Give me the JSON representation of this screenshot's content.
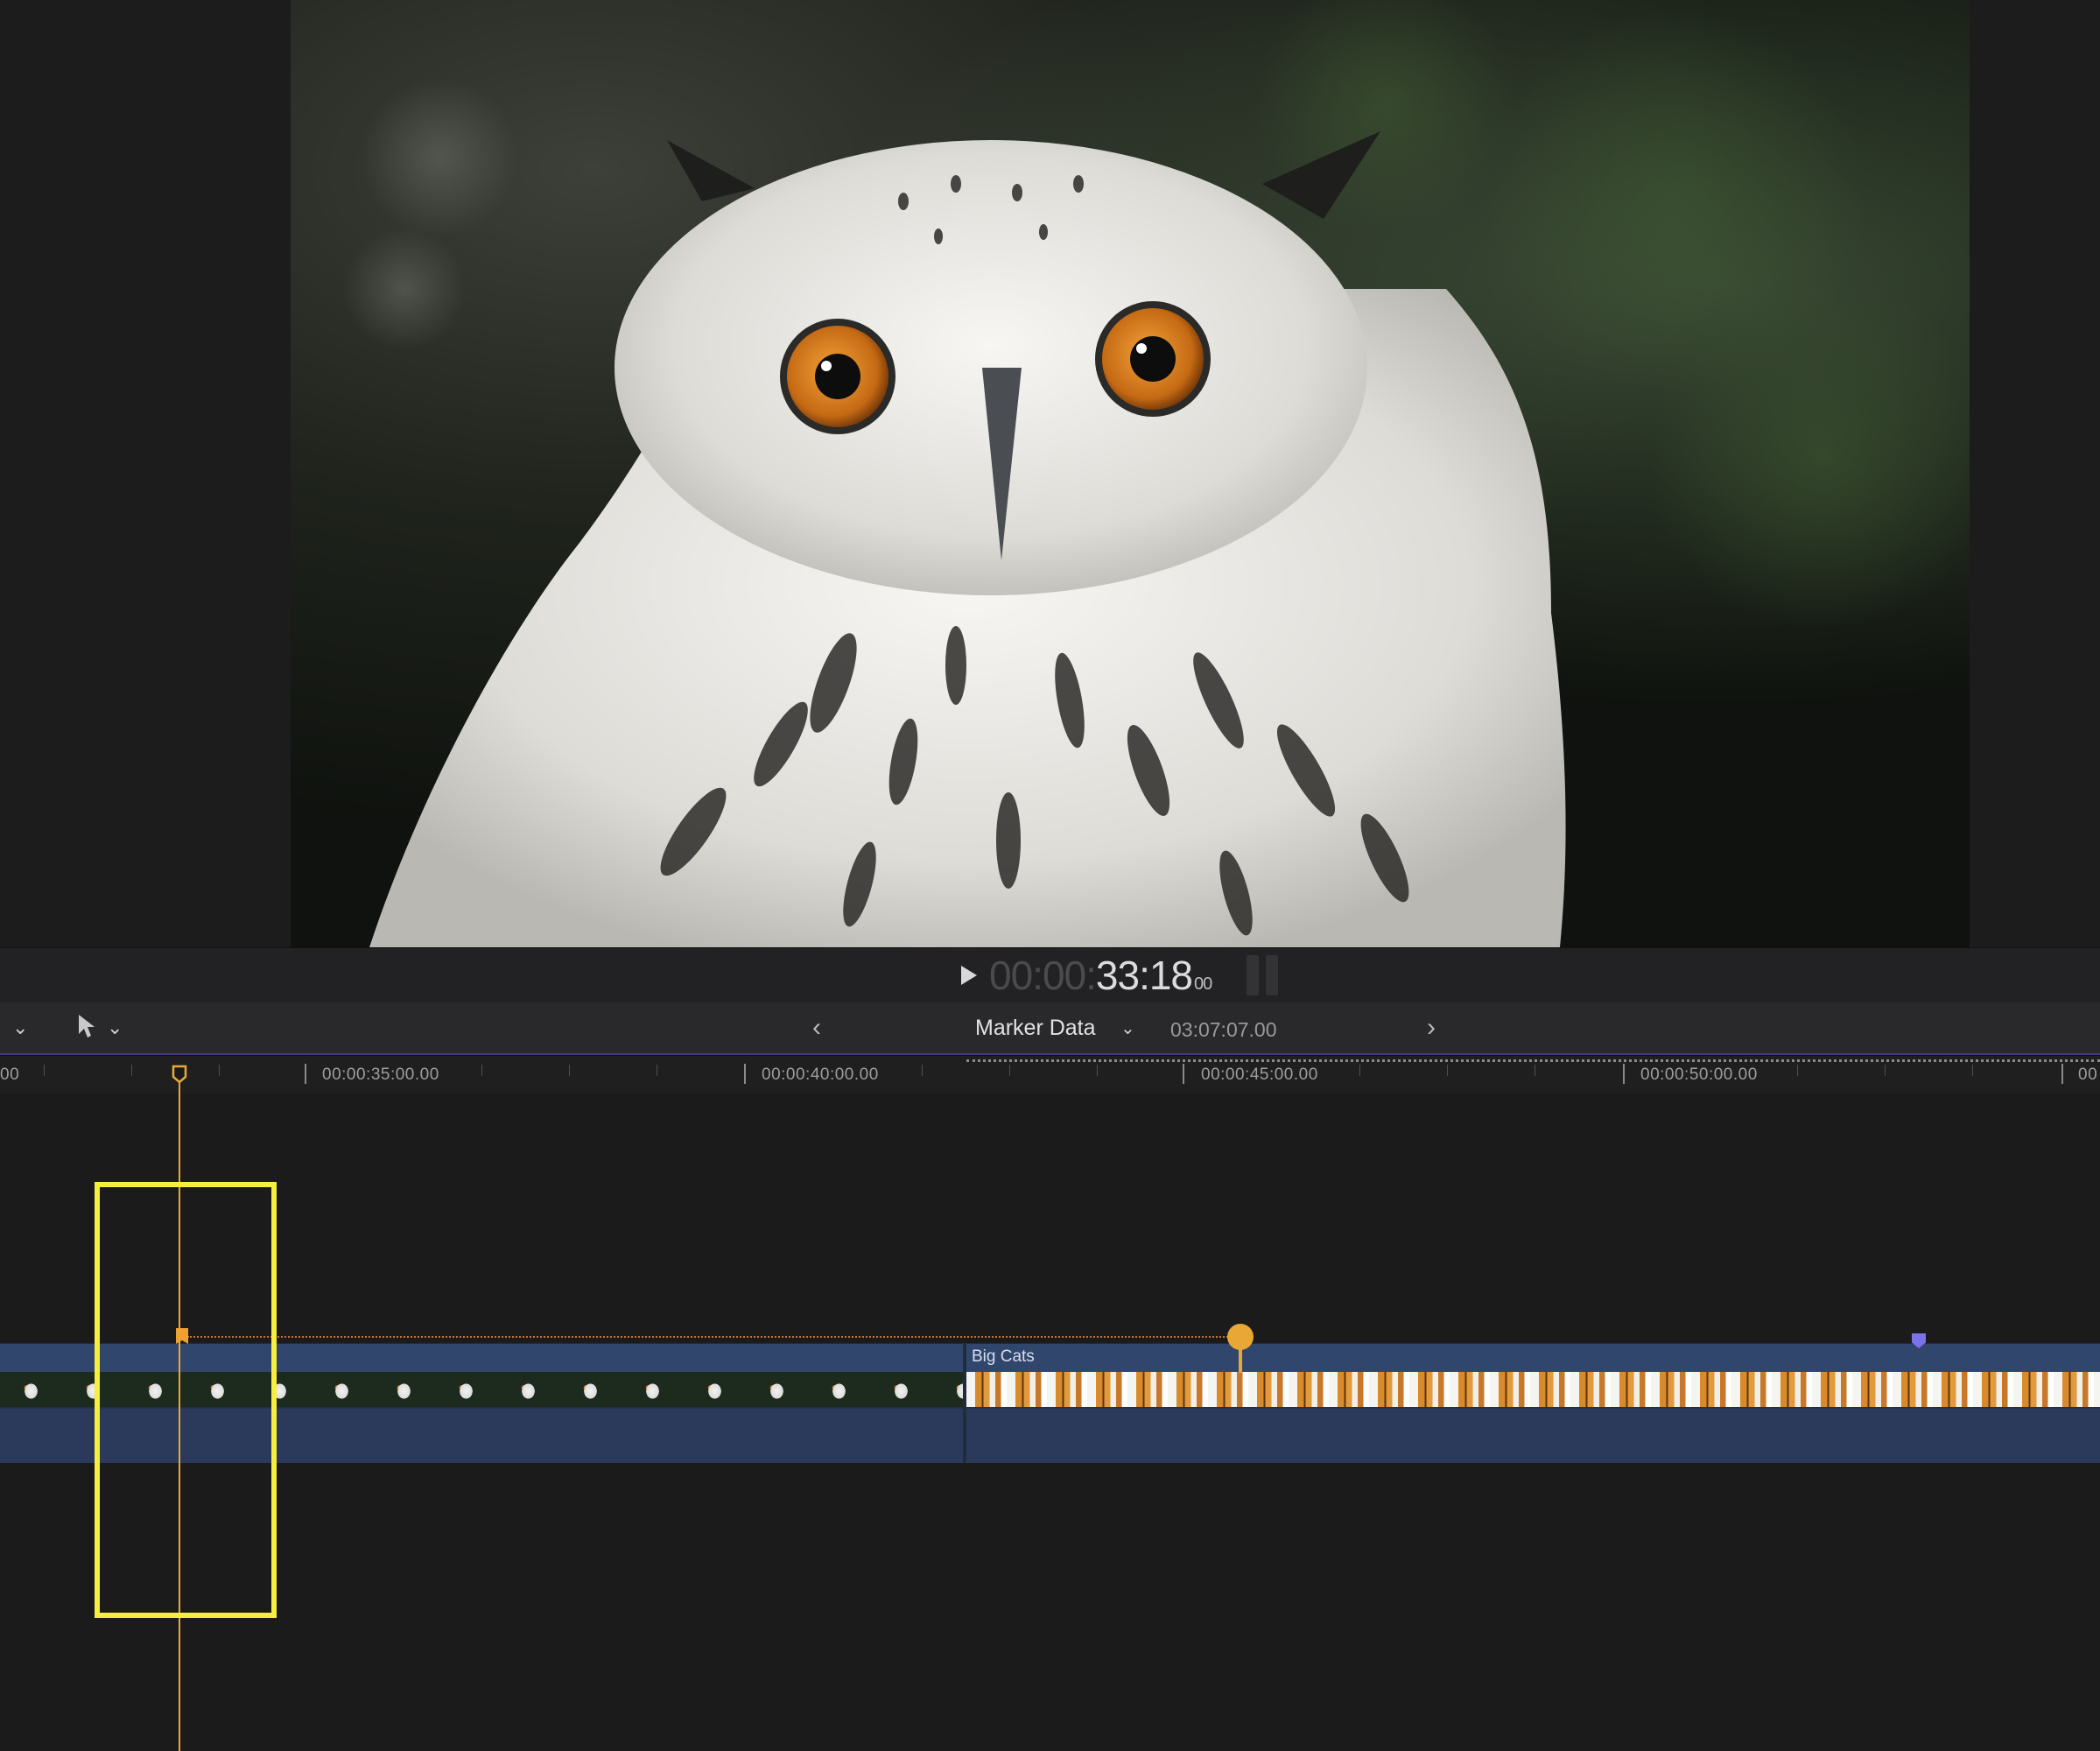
{
  "viewer": {
    "timecode": {
      "dim": "00:00:",
      "main": "33:18",
      "frames": "00"
    }
  },
  "toolbar": {
    "project_name": "Marker Data",
    "project_duration": "03:07:07.00",
    "prev_icon": "chevron-left-icon",
    "next_icon": "chevron-right-icon",
    "select_tool_icon": "arrow-pointer-icon"
  },
  "ruler": {
    "labels": [
      "00",
      "00:00:35:00.00",
      "00:00:40:00.00",
      "00:00:45:00.00",
      "00:00:50:00.00",
      "00"
    ]
  },
  "timeline": {
    "clips": [
      {
        "name": "",
        "content": "owl"
      },
      {
        "name": "Big Cats",
        "content": "tigers"
      }
    ],
    "markers": [
      {
        "type": "to-do",
        "color": "#f0a030"
      },
      {
        "type": "chapter",
        "color": "#e9a735"
      },
      {
        "type": "standard",
        "color": "#7b71ea"
      }
    ]
  },
  "colors": {
    "playhead": "#e7a93a",
    "highlight": "#f7ee3f",
    "clip_blue": "#2b3a5a"
  }
}
